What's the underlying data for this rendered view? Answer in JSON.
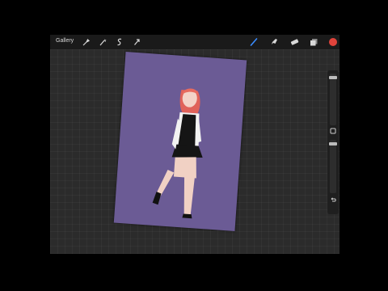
{
  "toolbar": {
    "gallery_label": "Gallery",
    "left_icons": [
      "wrench-icon",
      "magic-wand-icon",
      "selection-icon",
      "transform-arrow-icon"
    ],
    "right_icons": [
      "brush-icon",
      "smudge-icon",
      "eraser-icon",
      "layers-icon"
    ],
    "active_color": "#e0433b",
    "active_tool_color": "#3a8dff"
  },
  "sidebar": {
    "icons": [
      "modify-square-icon",
      "undo-icon"
    ]
  },
  "canvas": {
    "background_color": "#6b5b95"
  }
}
